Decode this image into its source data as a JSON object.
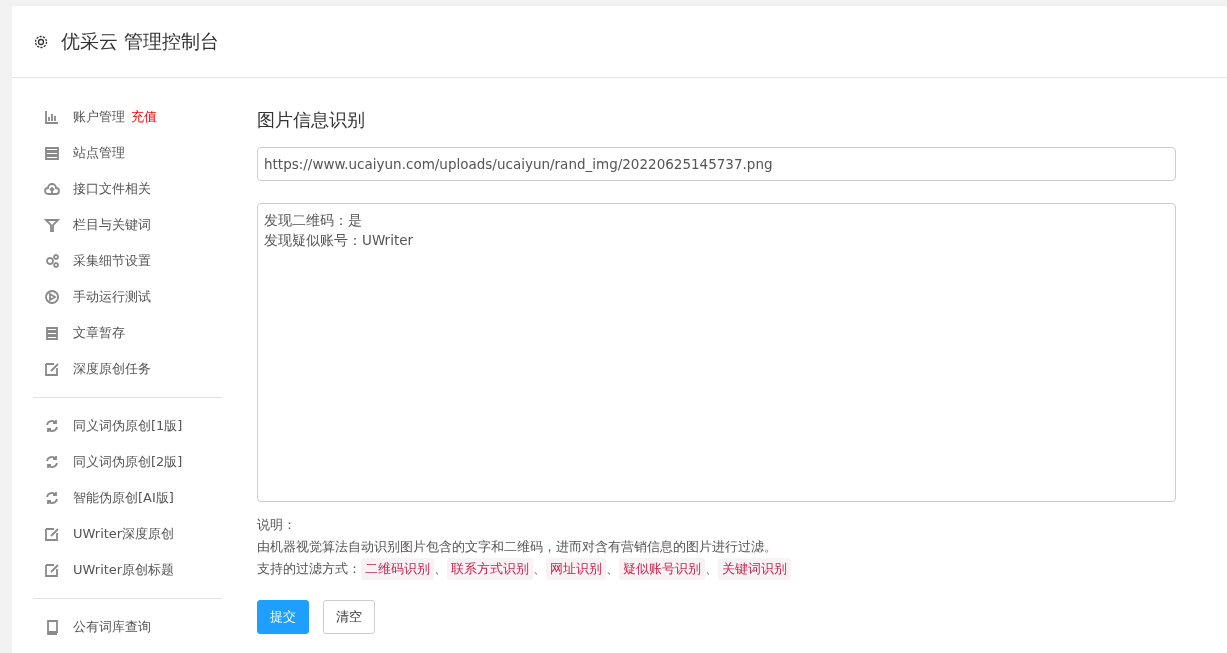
{
  "header": {
    "title": "优采云 管理控制台"
  },
  "sidebar": {
    "groups": [
      [
        {
          "label": "账户管理",
          "badge": "充值"
        },
        {
          "label": "站点管理"
        },
        {
          "label": "接口文件相关"
        },
        {
          "label": "栏目与关键词"
        },
        {
          "label": "采集细节设置"
        },
        {
          "label": "手动运行测试"
        },
        {
          "label": "文章暂存"
        },
        {
          "label": "深度原创任务"
        }
      ],
      [
        {
          "label": "同义词伪原创[1版]"
        },
        {
          "label": "同义词伪原创[2版]"
        },
        {
          "label": "智能伪原创[AI版]"
        },
        {
          "label": "UWriter深度原创"
        },
        {
          "label": "UWriter原创标题"
        }
      ],
      [
        {
          "label": "公有词库查询"
        }
      ]
    ]
  },
  "main": {
    "title": "图片信息识别",
    "url_field": {
      "value": "https://www.ucaiyun.com/uploads/ucaiyun/rand_img/20220625145737.png"
    },
    "result_box": {
      "lines": [
        "发现二维码：是",
        "发现疑似账号：UWriter"
      ]
    },
    "notes": {
      "heading": "说明：",
      "description": "由机器视觉算法自动识别图片包含的文字和二维码，进而对含有营销信息的图片进行过滤。",
      "filters_label": "支持的过滤方式：",
      "separator": "、",
      "filters": [
        "二维码识别",
        "联系方式识别",
        "网址识别",
        "疑似账号识别",
        "关键词识别"
      ]
    },
    "buttons": [
      {
        "label": "提交",
        "kind": "primary"
      },
      {
        "label": "清空",
        "kind": "default"
      }
    ]
  }
}
